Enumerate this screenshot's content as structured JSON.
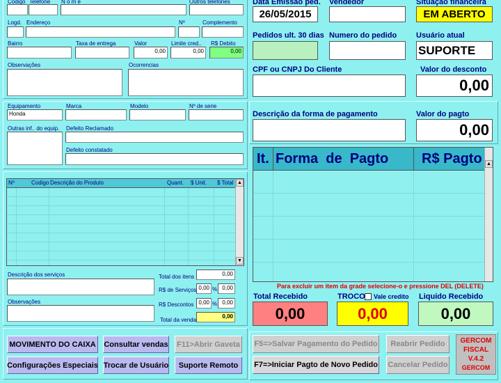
{
  "customer": {
    "codigo_label": "Codigo",
    "telefone_label": "Telefone",
    "nome_label": "N o m e",
    "outros_telefones_label": "Outros telefones",
    "logd_label": "Logd.",
    "endereco_label": "Endereço",
    "numero_label": "Nº",
    "complemento_label": "Complemento",
    "bairro_label": "Bairro",
    "taxa_entrega_label": "Taxa de entrega",
    "valor_label": "Valor",
    "valor_value": "0,00",
    "limite_cred_label": "Limite cred..",
    "limite_cred_value": "0,00",
    "rs_debito_label": "R$ Debito",
    "rs_debito_value": "0,00",
    "observacoes_label": "Observações",
    "ocorrencias_label": "Ocorrencias"
  },
  "equipment": {
    "equipamento_label": "Equipamento",
    "equipamento_value": "Honda",
    "marca_label": "Marca",
    "modelo_label": "Modelo",
    "serie_label": "Nº de serie",
    "outras_inf_label": "Outras inf.. do equip.",
    "defeito_reclamado_label": "Defeito Reclamado",
    "defeito_constatado_label": "Defeito constatado"
  },
  "products": {
    "columns": [
      "Nº",
      "Codigo",
      "Descrição do Produto",
      "Quant.",
      "$ Unit.",
      "$ Total"
    ]
  },
  "services": {
    "descricao_label": "Descrição dos serviços",
    "observacoes_label": "Observações",
    "total_itens_label": "Total  dos  itens",
    "total_itens_value": "0,00",
    "rs_servicos_label": "R$ de Serviços",
    "rs_servicos_pct": "0,00",
    "rs_servicos_value": "0,00",
    "rs_descontos_label": "R$  Descontos",
    "rs_descontos_pct": "0,00",
    "rs_descontos_value": "0,00",
    "pct_symbol": "%",
    "total_venda_label": "Total da venda",
    "total_venda_value": "0,00"
  },
  "buttons": {
    "movimento_caixa": "MOVIMENTO DO CAIXA",
    "consultar_vendas": "Consultar vendas",
    "abrir_gaveta": "F11>Abrir Gaveta",
    "config_especiais": "Configurações Especiais",
    "trocar_usuario": "Trocar de Usuário",
    "suporte_remoto": "Suporte Remoto",
    "salvar_pagamento": "F5=>Salvar Pagamento do Pedido",
    "reabrir_pedido": "Reabrir Pedido",
    "iniciar_pagto": "F7=>Iniciar Pagto de Novo Pedido",
    "cancelar_pedido": "Cancelar Pedido"
  },
  "order": {
    "data_emissao_label": "Data Emissão ped.",
    "data_emissao_value": "26/05/2015",
    "vendedor_label": "Vendedor",
    "situacao_label": "Situação financeira",
    "situacao_value": "EM ABERTO",
    "pedidos_30_label": "Pedidos ult. 30 dias",
    "numero_pedido_label": "Numero do pedido",
    "usuario_label": "Usuário atual",
    "usuario_value": "SUPORTE",
    "cpf_label": "CPF  ou  CNPJ Do Cliente",
    "desconto_label": "Valor do desconto",
    "desconto_value": "0,00",
    "forma_pagamento_label": "Descrição da forma de pagamento",
    "valor_pagto_label": "Valor do pagto",
    "valor_pagto_value": "0,00"
  },
  "payments_grid": {
    "columns": [
      "It.",
      "Forma  de  Pagto",
      "R$ Pagto"
    ]
  },
  "totals": {
    "hint": "Para excluir um item da grade selecione-o e pressione DEL (DELETE)",
    "total_recebido_label": "Total Recebido",
    "total_recebido_value": "0,00",
    "troco_label": "TROCO",
    "vale_credito_label": "Vale credito",
    "troco_value": "0,00",
    "liquido_label": "Liquido Recebido",
    "liquido_value": "0,00"
  },
  "brand": {
    "line1": "GERCOM",
    "line2": "FISCAL",
    "line3": "V.4.2",
    "line4": "GERCOM"
  }
}
